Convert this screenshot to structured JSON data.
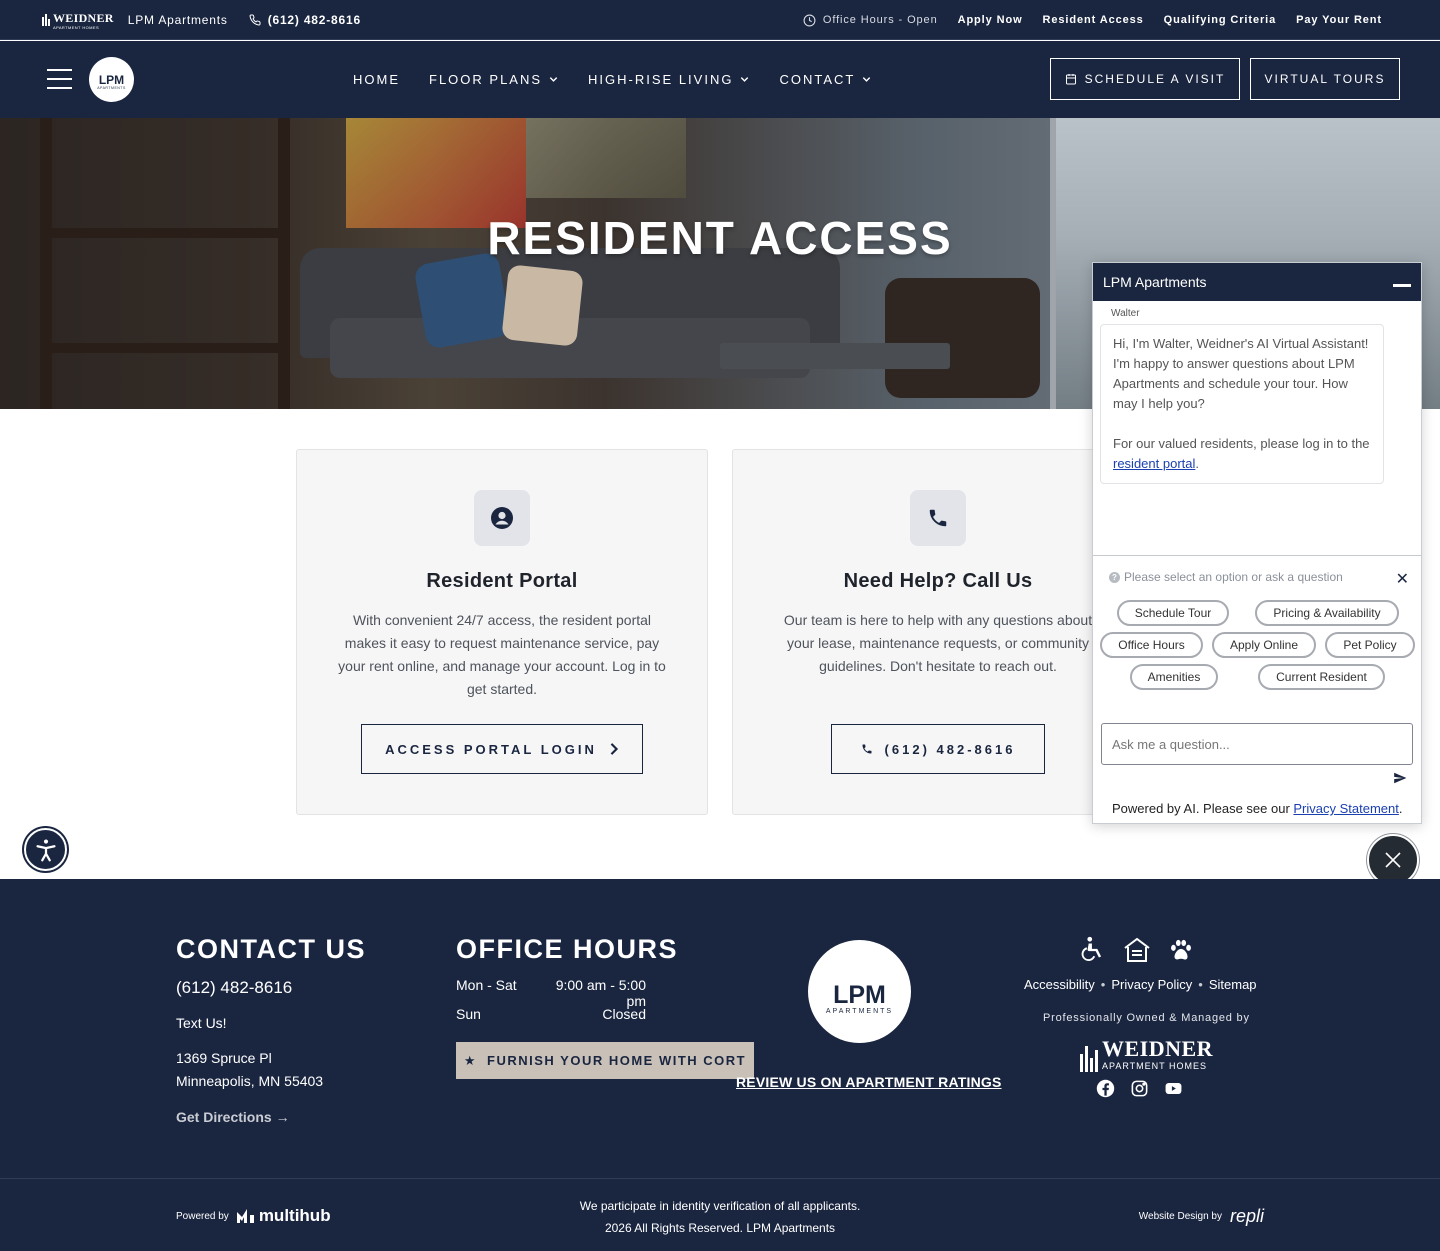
{
  "topbar": {
    "brand_logo": "WEIDNER",
    "brand_logo_sub": "APARTMENT HOMES",
    "property_name": "LPM Apartments",
    "phone": "(612) 482-8616",
    "office_hours": "Office Hours - Open",
    "links": [
      "Apply Now",
      "Resident Access",
      "Qualifying Criteria",
      "Pay Your Rent"
    ]
  },
  "nav": {
    "logo_text": "LPM",
    "logo_sub": "APARTMENTS",
    "items": [
      {
        "label": "HOME",
        "dropdown": false
      },
      {
        "label": "FLOOR PLANS",
        "dropdown": true
      },
      {
        "label": "HIGH-RISE LIVING",
        "dropdown": true
      },
      {
        "label": "CONTACT",
        "dropdown": true
      }
    ],
    "schedule_button": "SCHEDULE A VISIT",
    "tours_button": "VIRTUAL TOURS"
  },
  "hero": {
    "title": "RESIDENT ACCESS"
  },
  "cards": [
    {
      "icon": "user-circle-icon",
      "title": "Resident Portal",
      "text": "With convenient 24/7 access, the resident portal makes it easy to request maintenance service, pay your rent online, and manage your account. Log in to get started.",
      "button": "ACCESS PORTAL LOGIN"
    },
    {
      "icon": "phone-icon",
      "title": "Need Help? Call Us",
      "text": "Our team is here to help with any questions about your lease, maintenance requests, or community guidelines. Don't hesitate to reach out.",
      "button": "(612) 482-8616"
    }
  ],
  "chat": {
    "title": "LPM Apartments",
    "sender": "Walter",
    "message_1": "Hi, I'm Walter, Weidner's AI Virtual Assistant! I'm happy to answer questions about LPM Apartments and schedule your tour. How may I help you?",
    "message_2_prefix": "For our valued residents, please log in to the ",
    "message_2_link": "resident portal",
    "message_2_suffix": ".",
    "prompt": "Please select an option or ask a question",
    "chips": [
      "Schedule Tour",
      "Pricing & Availability",
      "Office Hours",
      "Apply Online",
      "Pet Policy",
      "Amenities",
      "Current Resident"
    ],
    "input_placeholder": "Ask me a question...",
    "footer_prefix": "Powered by AI. Please see our ",
    "footer_link": "Privacy Statement",
    "footer_suffix": "."
  },
  "footer": {
    "contact_heading": "CONTACT US",
    "phone": "(612) 482-8616",
    "text_us": "Text Us!",
    "address_line1": "1369 Spruce Pl",
    "address_line2": "Minneapolis, MN 55403",
    "directions": "Get Directions →",
    "hours_heading": "OFFICE HOURS",
    "hours": [
      {
        "day": "Mon - Sat",
        "time": "9:00 am - 5:00 pm"
      },
      {
        "day": "Sun",
        "time": "Closed"
      }
    ],
    "cort_button": "FURNISH YOUR HOME WITH CORT",
    "logo_text": "LPM",
    "logo_sub": "APARTMENTS",
    "review_link": "REVIEW US ON APARTMENT RATINGS",
    "links": [
      "Accessibility",
      "Privacy Policy",
      "Sitemap"
    ],
    "managed_by": "Professionally Owned & Managed by",
    "weidner_logo": "WEIDNER",
    "weidner_sub": "APARTMENT HOMES",
    "powered_by": "Powered by",
    "powered_brand": "multihub",
    "legal_line1": "We participate in identity verification of all applicants.",
    "legal_line2": "2026 All Rights Reserved. LPM Apartments",
    "design_by": "Website Design by",
    "design_brand": "repli"
  },
  "colors": {
    "navy": "#1a2640",
    "cort_bg": "#c9c0b8",
    "card_bg": "#f6f6f6",
    "link_blue": "#1a3fb0"
  }
}
